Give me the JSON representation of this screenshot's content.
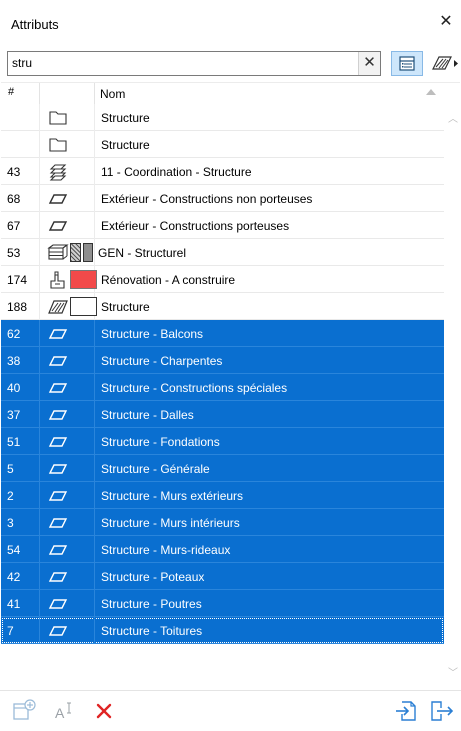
{
  "window": {
    "title": "Attributs",
    "close_glyph": "✕"
  },
  "search": {
    "value": "stru",
    "clear_glyph": "✕"
  },
  "toolbar": {
    "view_icon": "list-view-icon",
    "filter_icon": "fill-hatch-icon"
  },
  "table": {
    "header_num": "#",
    "header_name": "Nom",
    "rows": [
      {
        "num": "",
        "icon": "folder-icon",
        "name": "Structure",
        "selected": false
      },
      {
        "num": "",
        "icon": "folder-icon",
        "name": "Structure",
        "selected": false
      },
      {
        "num": "43",
        "icon": "layer-combination-icon",
        "name": "11 - Coordination - Structure",
        "selected": false
      },
      {
        "num": "68",
        "icon": "layer-icon",
        "name": "Extérieur - Constructions non porteuses",
        "selected": false
      },
      {
        "num": "67",
        "icon": "layer-icon",
        "name": "Extérieur - Constructions porteuses",
        "selected": false
      },
      {
        "num": "53",
        "icon": "composite-icon",
        "name": "GEN - Structurel",
        "selected": false
      },
      {
        "num": "174",
        "icon": "renovation-filter-icon",
        "name": "Rénovation - A construire",
        "selected": false
      },
      {
        "num": "188",
        "icon": "fill-icon",
        "name": "Structure",
        "selected": false
      },
      {
        "num": "62",
        "icon": "layer-icon",
        "name": "Structure - Balcons",
        "selected": true
      },
      {
        "num": "38",
        "icon": "layer-icon",
        "name": "Structure - Charpentes",
        "selected": true
      },
      {
        "num": "40",
        "icon": "layer-icon",
        "name": "Structure - Constructions spéciales",
        "selected": true
      },
      {
        "num": "37",
        "icon": "layer-icon",
        "name": "Structure - Dalles",
        "selected": true
      },
      {
        "num": "51",
        "icon": "layer-icon",
        "name": "Structure - Fondations",
        "selected": true
      },
      {
        "num": "5",
        "icon": "layer-icon",
        "name": "Structure - Générale",
        "selected": true
      },
      {
        "num": "2",
        "icon": "layer-icon",
        "name": "Structure - Murs extérieurs",
        "selected": true
      },
      {
        "num": "3",
        "icon": "layer-icon",
        "name": "Structure - Murs intérieurs",
        "selected": true
      },
      {
        "num": "54",
        "icon": "layer-icon",
        "name": "Structure - Murs-rideaux",
        "selected": true
      },
      {
        "num": "42",
        "icon": "layer-icon",
        "name": "Structure - Poteaux",
        "selected": true
      },
      {
        "num": "41",
        "icon": "layer-icon",
        "name": "Structure - Poutres",
        "selected": true
      },
      {
        "num": "7",
        "icon": "layer-icon",
        "name": "Structure - Toitures",
        "selected": true
      }
    ]
  },
  "colors": {
    "selection": "#0a6fd0",
    "renovation_swatch": "#f24a4a",
    "delete": "#e02424",
    "action_blue": "#2b7fd4"
  },
  "bottom": {
    "new_icon": "new-attribute-icon",
    "rename_icon": "rename-icon",
    "delete_icon": "delete-icon",
    "import_icon": "import-icon",
    "export_icon": "export-icon"
  }
}
